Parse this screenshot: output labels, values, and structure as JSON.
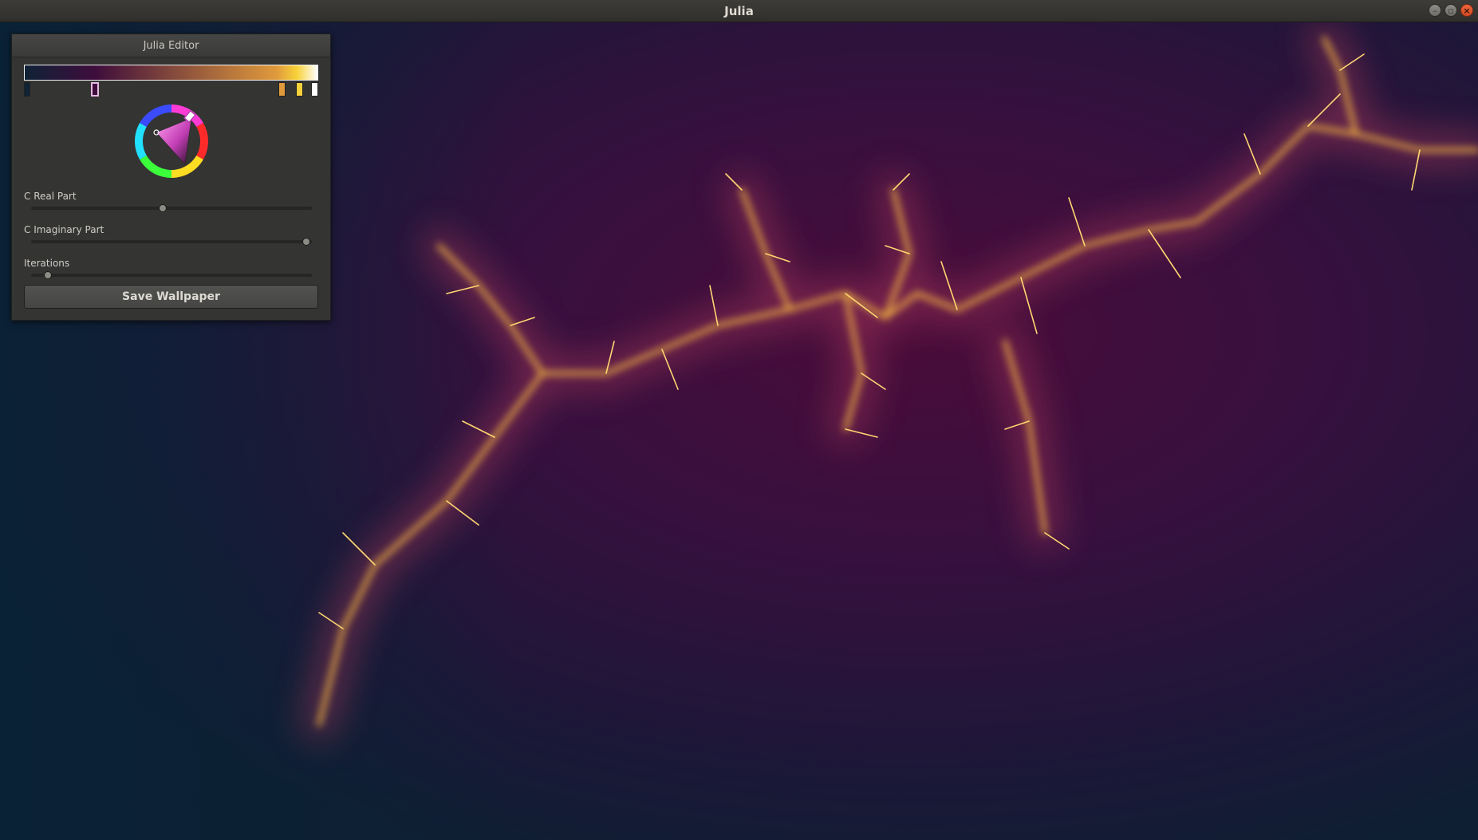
{
  "window": {
    "title": "Julia"
  },
  "editor": {
    "title": "Julia Editor",
    "gradient_stops": [
      {
        "color": "#0f2236"
      },
      {
        "color": "#3e0d3c"
      },
      {
        "color": "#e09a3c"
      },
      {
        "color": "#f8d23a"
      },
      {
        "color": "#ffffff"
      }
    ],
    "selected_stop_index": 1,
    "sliders": [
      {
        "label": "C Real Part",
        "value": 0.47
      },
      {
        "label": "C Imaginary Part",
        "value": 0.98
      },
      {
        "label": "Iterations",
        "value": 0.06
      }
    ],
    "save_label": "Save Wallpaper"
  },
  "icons": {
    "minimize": "minimize-icon",
    "maximize": "maximize-icon",
    "close": "close-icon",
    "color_wheel": "color-wheel-icon"
  }
}
